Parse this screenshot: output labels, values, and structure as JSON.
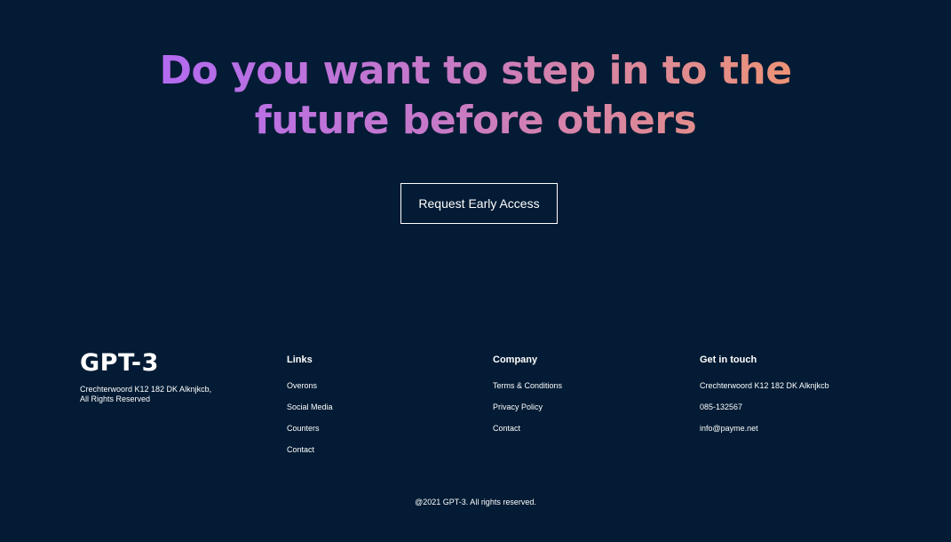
{
  "cta": {
    "headline": "Do you want to step in to the future before others",
    "button_label": "Request Early Access"
  },
  "colors": {
    "background": "#031B34",
    "gradient_start": "#AE67FA",
    "gradient_end": "#F49867",
    "text": "#FFFFFF"
  },
  "footer": {
    "logo": "GPT-3",
    "address_line1": "Crechterwoord K12 182 DK Alknjkcb,",
    "address_line2": "All Rights Reserved",
    "links": {
      "title": "Links",
      "items": [
        "Overons",
        "Social Media",
        "Counters",
        "Contact"
      ]
    },
    "company": {
      "title": "Company",
      "items": [
        "Terms & Conditions",
        "Privacy Policy",
        "Contact"
      ]
    },
    "contact": {
      "title": "Get in touch",
      "items": [
        "Crechterwoord K12 182 DK Alknjkcb",
        "085-132567",
        "info@payme.net"
      ]
    },
    "copyright": "@2021 GPT-3. All rights reserved."
  }
}
